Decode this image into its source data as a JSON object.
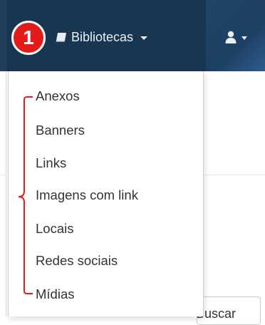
{
  "navbar": {
    "libraries_label": "Bibliotecas",
    "library_icon": "book-icon",
    "user_icon": "user-icon"
  },
  "annotation": {
    "step_number": "1",
    "color": "#e41b1b"
  },
  "dropdown": {
    "items": [
      {
        "label": "Anexos"
      },
      {
        "label": "Banners"
      },
      {
        "label": "Links"
      },
      {
        "label": "Imagens com link"
      },
      {
        "label": "Locais"
      },
      {
        "label": "Redes sociais"
      },
      {
        "label": "Mídias"
      }
    ]
  },
  "background": {
    "search_button_label": "Buscar"
  },
  "colors": {
    "navbar": "#1b3a55",
    "accent_red": "#e41b1b"
  }
}
